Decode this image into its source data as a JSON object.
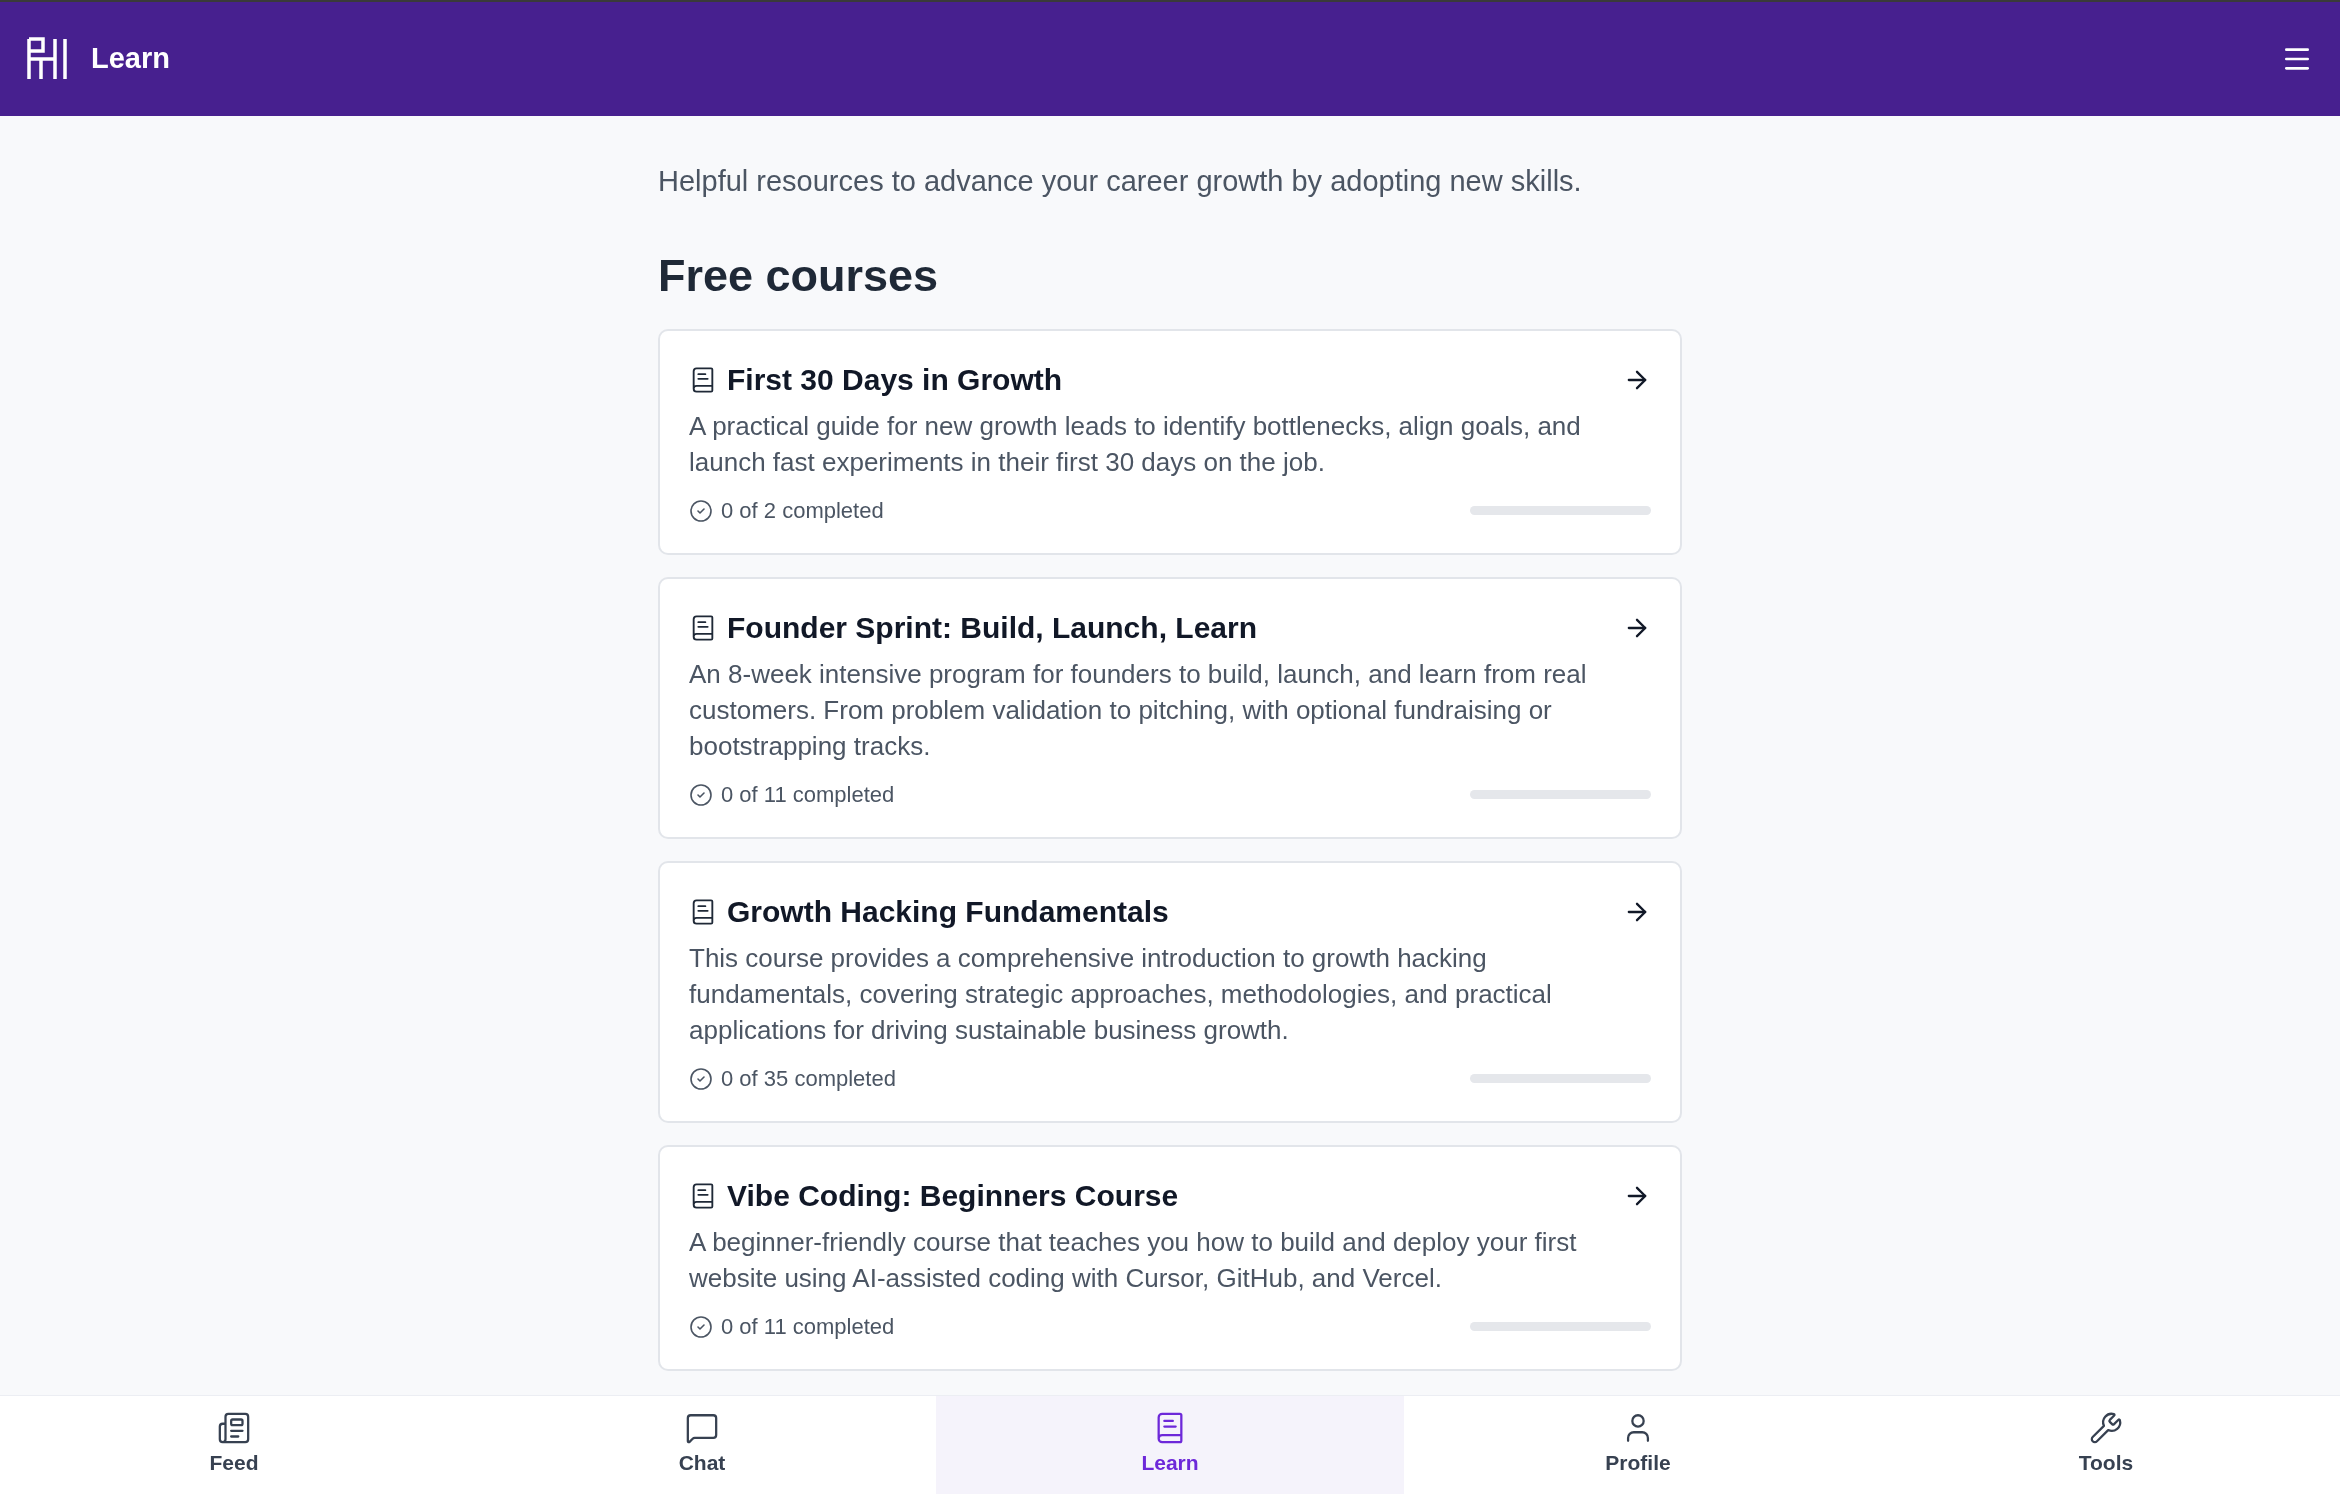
{
  "header": {
    "title": "Learn"
  },
  "intro": "Helpful resources to advance your career growth by adopting new skills.",
  "section_title": "Free courses",
  "courses": [
    {
      "title": "First 30 Days in Growth",
      "description": "A practical guide for new growth leads to identify bottlenecks, align goals, and launch fast experiments in their first 30 days on the job.",
      "progress": "0 of 2 completed",
      "level": 0
    },
    {
      "title": "Founder Sprint: Build, Launch, Learn",
      "description": "An 8-week intensive program for founders to build, launch, and learn from real customers. From problem validation to pitching, with optional fundraising or bootstrapping tracks.",
      "progress": "0 of 11 completed",
      "level": 0
    },
    {
      "title": "Growth Hacking Fundamentals",
      "description": "This course provides a comprehensive introduction to growth hacking fundamentals, covering strategic approaches, methodologies, and practical applications for driving sustainable business growth.",
      "progress": "0 of 35 completed",
      "level": 0
    },
    {
      "title": "Vibe Coding: Beginners Course",
      "description": "A beginner-friendly course that teaches you how to build and deploy your first website using AI-assisted coding with Cursor, GitHub, and Vercel.",
      "progress": "0 of 11 completed",
      "level": 0
    }
  ],
  "nav": [
    {
      "label": "Feed",
      "selected": false
    },
    {
      "label": "Chat",
      "selected": false
    },
    {
      "label": "Learn",
      "selected": true
    },
    {
      "label": "Profile",
      "selected": false
    },
    {
      "label": "Tools",
      "selected": false
    }
  ]
}
